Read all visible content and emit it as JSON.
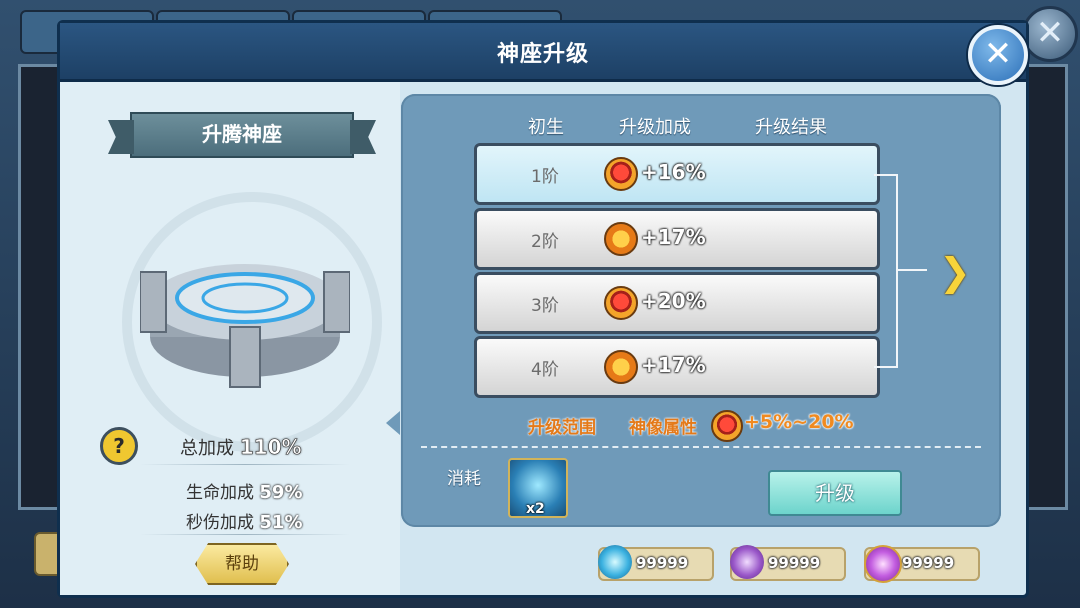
{
  "dialog": {
    "title": "神座升级",
    "close_label": "✕"
  },
  "left": {
    "ribbon_label": "升腾神座",
    "help_q": "?",
    "total_label": "总加成",
    "total_value": "110%",
    "stats": [
      {
        "label": "生命加成",
        "value": "59%"
      },
      {
        "label": "秒伤加成",
        "value": "51%"
      }
    ],
    "help_button": "帮助"
  },
  "right": {
    "columns": [
      "初生",
      "升级加成",
      "升级结果"
    ],
    "tiers": [
      {
        "label": "1阶",
        "icon": "heart-gem-icon",
        "value": "+16%",
        "active": true
      },
      {
        "label": "2阶",
        "icon": "sword-gem-icon",
        "value": "+17%",
        "active": false
      },
      {
        "label": "3阶",
        "icon": "heart-gem-icon",
        "value": "+20%",
        "active": false
      },
      {
        "label": "4阶",
        "icon": "sword-gem-icon",
        "value": "+17%",
        "active": false
      }
    ],
    "next_icon": "chevron-right-icon",
    "range_label": "升级范围",
    "attr_label": "神像属性",
    "attr_range": "+5%~20%",
    "cost_label": "消耗",
    "cost_item_qty": "x2",
    "upgrade_button": "升级"
  },
  "currencies": [
    {
      "icon": "blue-crystal-icon",
      "value": "99999"
    },
    {
      "icon": "purple-crystal-icon",
      "value": "99999"
    },
    {
      "icon": "purple-gem-icon",
      "value": "99999"
    }
  ],
  "colors": {
    "header": "#2b5682",
    "panel": "#d2e6f1",
    "right_panel": "#6f9ab9",
    "orange_text": "#e47a1a",
    "upgrade_button": "#6dd4cc",
    "help_button": "#e0bf4f"
  }
}
